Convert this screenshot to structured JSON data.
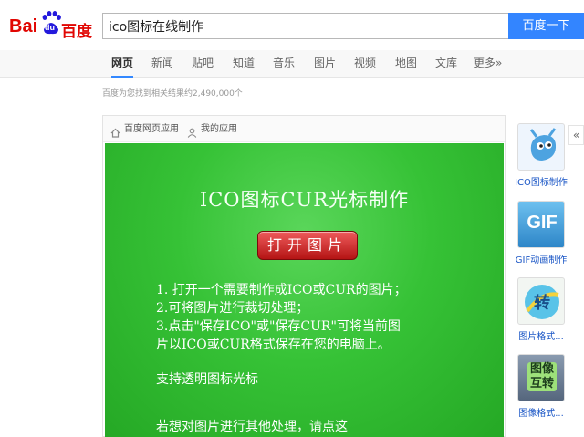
{
  "logo": {
    "part1": "Bai",
    "part2": "百度",
    "paw_text": "du"
  },
  "search": {
    "query": "ico图标在线制作",
    "button_label": "百度一下"
  },
  "nav": {
    "items": [
      {
        "label": "网页",
        "active": true
      },
      {
        "label": "新闻"
      },
      {
        "label": "贴吧"
      },
      {
        "label": "知道"
      },
      {
        "label": "音乐"
      },
      {
        "label": "图片"
      },
      {
        "label": "视频"
      },
      {
        "label": "地图"
      },
      {
        "label": "文库"
      },
      {
        "label": "更多»"
      }
    ]
  },
  "result_count": "百度为您找到相关结果约2,490,000个",
  "app": {
    "breadcrumb_home": "百度网页应用",
    "breadcrumb_mine": "我的应用",
    "title": "ICO图标CUR光标制作",
    "open_button": "打开图片",
    "instructions": [
      "1. 打开一个需要制作成ICO或CUR的图片；",
      "2.可将图片进行裁切处理；",
      "3.点击\"保存ICO\"或\"保存CUR\"可将当前图",
      "片以ICO或CUR格式保存在您的电脑上。"
    ],
    "transparent_note": "支持透明图标光标",
    "more_link": "若想对图片进行其他处理，请点这"
  },
  "sidebar": {
    "items": [
      {
        "label": "ICO图标制作",
        "icon": "gimp-icon"
      },
      {
        "label": "GIF动画制作",
        "icon": "gif-icon",
        "tile_text": "GIF"
      },
      {
        "label": "图片格式...",
        "icon": "convert-icon",
        "tile_text": "转"
      },
      {
        "label": "图像格式...",
        "icon": "image-convert-icon",
        "tile_text": "图像互转"
      }
    ],
    "collapse": "«"
  },
  "colors": {
    "accent": "#3385ff",
    "logo_red": "#e10602",
    "logo_blue": "#2319dc",
    "panel_green": "#36c236"
  }
}
